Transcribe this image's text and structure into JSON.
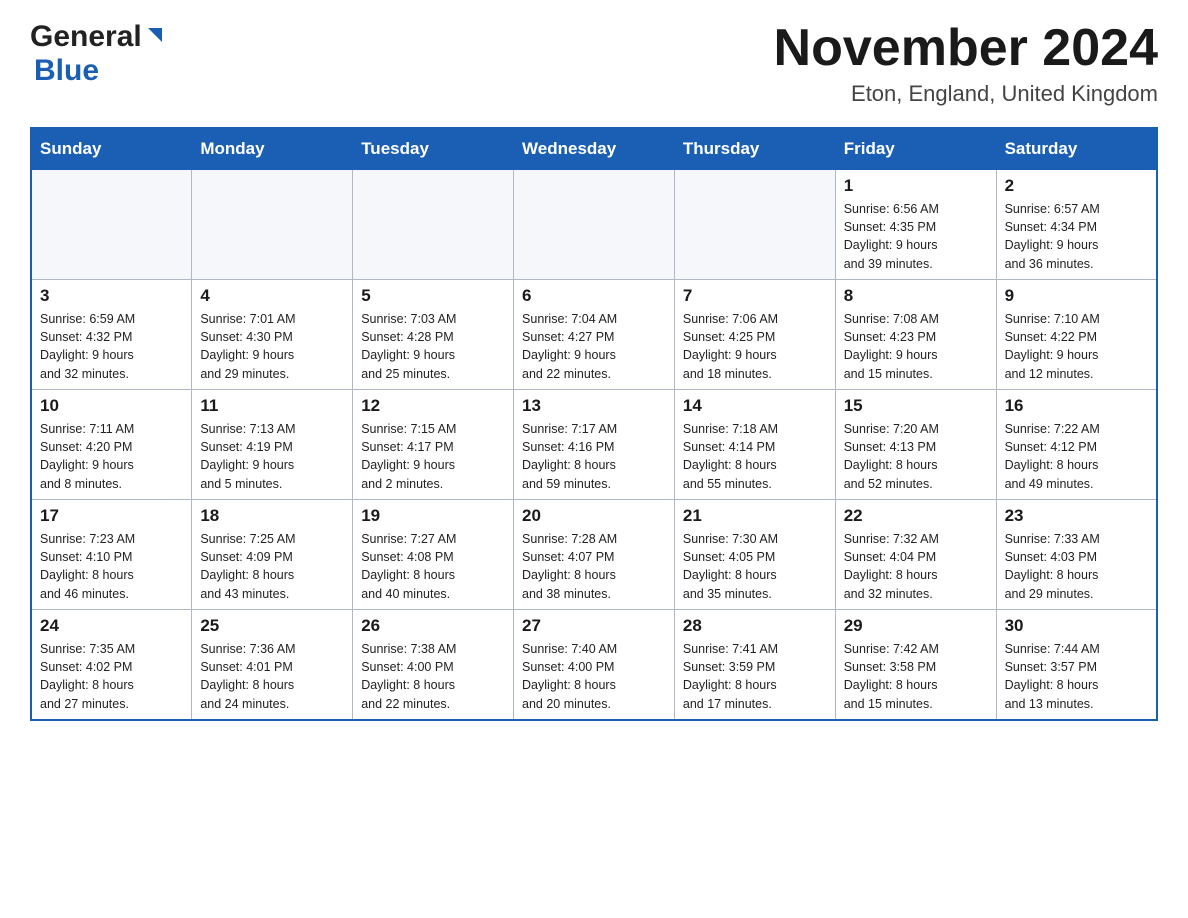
{
  "header": {
    "month_title": "November 2024",
    "location": "Eton, England, United Kingdom",
    "logo_general": "General",
    "logo_blue": "Blue"
  },
  "weekdays": [
    "Sunday",
    "Monday",
    "Tuesday",
    "Wednesday",
    "Thursday",
    "Friday",
    "Saturday"
  ],
  "weeks": [
    [
      {
        "day": "",
        "info": ""
      },
      {
        "day": "",
        "info": ""
      },
      {
        "day": "",
        "info": ""
      },
      {
        "day": "",
        "info": ""
      },
      {
        "day": "",
        "info": ""
      },
      {
        "day": "1",
        "info": "Sunrise: 6:56 AM\nSunset: 4:35 PM\nDaylight: 9 hours\nand 39 minutes."
      },
      {
        "day": "2",
        "info": "Sunrise: 6:57 AM\nSunset: 4:34 PM\nDaylight: 9 hours\nand 36 minutes."
      }
    ],
    [
      {
        "day": "3",
        "info": "Sunrise: 6:59 AM\nSunset: 4:32 PM\nDaylight: 9 hours\nand 32 minutes."
      },
      {
        "day": "4",
        "info": "Sunrise: 7:01 AM\nSunset: 4:30 PM\nDaylight: 9 hours\nand 29 minutes."
      },
      {
        "day": "5",
        "info": "Sunrise: 7:03 AM\nSunset: 4:28 PM\nDaylight: 9 hours\nand 25 minutes."
      },
      {
        "day": "6",
        "info": "Sunrise: 7:04 AM\nSunset: 4:27 PM\nDaylight: 9 hours\nand 22 minutes."
      },
      {
        "day": "7",
        "info": "Sunrise: 7:06 AM\nSunset: 4:25 PM\nDaylight: 9 hours\nand 18 minutes."
      },
      {
        "day": "8",
        "info": "Sunrise: 7:08 AM\nSunset: 4:23 PM\nDaylight: 9 hours\nand 15 minutes."
      },
      {
        "day": "9",
        "info": "Sunrise: 7:10 AM\nSunset: 4:22 PM\nDaylight: 9 hours\nand 12 minutes."
      }
    ],
    [
      {
        "day": "10",
        "info": "Sunrise: 7:11 AM\nSunset: 4:20 PM\nDaylight: 9 hours\nand 8 minutes."
      },
      {
        "day": "11",
        "info": "Sunrise: 7:13 AM\nSunset: 4:19 PM\nDaylight: 9 hours\nand 5 minutes."
      },
      {
        "day": "12",
        "info": "Sunrise: 7:15 AM\nSunset: 4:17 PM\nDaylight: 9 hours\nand 2 minutes."
      },
      {
        "day": "13",
        "info": "Sunrise: 7:17 AM\nSunset: 4:16 PM\nDaylight: 8 hours\nand 59 minutes."
      },
      {
        "day": "14",
        "info": "Sunrise: 7:18 AM\nSunset: 4:14 PM\nDaylight: 8 hours\nand 55 minutes."
      },
      {
        "day": "15",
        "info": "Sunrise: 7:20 AM\nSunset: 4:13 PM\nDaylight: 8 hours\nand 52 minutes."
      },
      {
        "day": "16",
        "info": "Sunrise: 7:22 AM\nSunset: 4:12 PM\nDaylight: 8 hours\nand 49 minutes."
      }
    ],
    [
      {
        "day": "17",
        "info": "Sunrise: 7:23 AM\nSunset: 4:10 PM\nDaylight: 8 hours\nand 46 minutes."
      },
      {
        "day": "18",
        "info": "Sunrise: 7:25 AM\nSunset: 4:09 PM\nDaylight: 8 hours\nand 43 minutes."
      },
      {
        "day": "19",
        "info": "Sunrise: 7:27 AM\nSunset: 4:08 PM\nDaylight: 8 hours\nand 40 minutes."
      },
      {
        "day": "20",
        "info": "Sunrise: 7:28 AM\nSunset: 4:07 PM\nDaylight: 8 hours\nand 38 minutes."
      },
      {
        "day": "21",
        "info": "Sunrise: 7:30 AM\nSunset: 4:05 PM\nDaylight: 8 hours\nand 35 minutes."
      },
      {
        "day": "22",
        "info": "Sunrise: 7:32 AM\nSunset: 4:04 PM\nDaylight: 8 hours\nand 32 minutes."
      },
      {
        "day": "23",
        "info": "Sunrise: 7:33 AM\nSunset: 4:03 PM\nDaylight: 8 hours\nand 29 minutes."
      }
    ],
    [
      {
        "day": "24",
        "info": "Sunrise: 7:35 AM\nSunset: 4:02 PM\nDaylight: 8 hours\nand 27 minutes."
      },
      {
        "day": "25",
        "info": "Sunrise: 7:36 AM\nSunset: 4:01 PM\nDaylight: 8 hours\nand 24 minutes."
      },
      {
        "day": "26",
        "info": "Sunrise: 7:38 AM\nSunset: 4:00 PM\nDaylight: 8 hours\nand 22 minutes."
      },
      {
        "day": "27",
        "info": "Sunrise: 7:40 AM\nSunset: 4:00 PM\nDaylight: 8 hours\nand 20 minutes."
      },
      {
        "day": "28",
        "info": "Sunrise: 7:41 AM\nSunset: 3:59 PM\nDaylight: 8 hours\nand 17 minutes."
      },
      {
        "day": "29",
        "info": "Sunrise: 7:42 AM\nSunset: 3:58 PM\nDaylight: 8 hours\nand 15 minutes."
      },
      {
        "day": "30",
        "info": "Sunrise: 7:44 AM\nSunset: 3:57 PM\nDaylight: 8 hours\nand 13 minutes."
      }
    ]
  ]
}
